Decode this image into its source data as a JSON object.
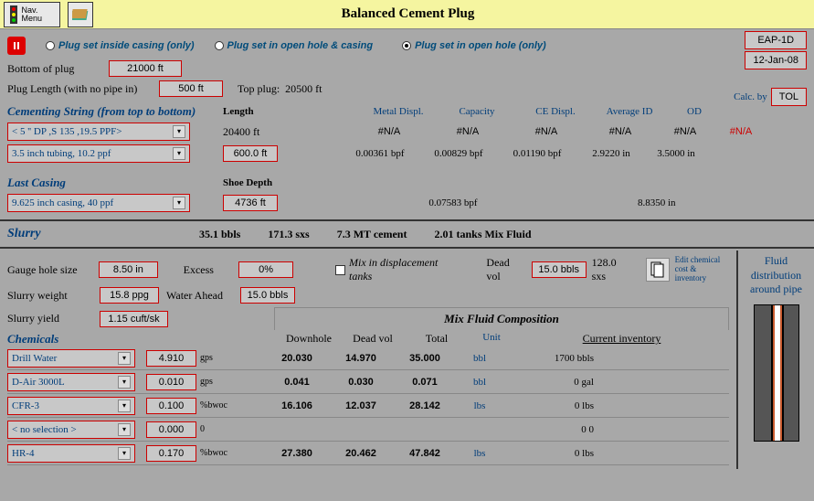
{
  "title": "Balanced Cement Plug",
  "nav_label": "Nav. Menu",
  "radios": {
    "opt1": "Plug set inside casing (only)",
    "opt2": "Plug set in open hole & casing",
    "opt3": "Plug set in open hole (only)"
  },
  "inputs": {
    "bottom_plug_label": "Bottom of plug",
    "bottom_plug": "21000 ft",
    "plug_len_label": "Plug  Length (with no pipe in)",
    "plug_len": "500 ft",
    "top_plug_label": "Top plug:",
    "top_plug": "20500 ft",
    "well": "EAP-1D",
    "date": "12-Jan-08",
    "calc_by": "Calc. by",
    "calc_val": "TOL"
  },
  "cs_header": "Cementing String (from top to bottom)",
  "cols": {
    "length": "Length",
    "md": "Metal Displ.",
    "cap": "Capacity",
    "ced": "CE Displ.",
    "avgid": "Average ID",
    "od": "OD"
  },
  "cs": [
    {
      "name": "< 5 '' DP ,S 135 ,19.5 PPF>",
      "len": "20400 ft",
      "md": "#N/A",
      "cap": "#N/A",
      "ced": "#N/A",
      "avgid": "#N/A",
      "od": "#N/A",
      "err": "#N/A"
    },
    {
      "name": "3.5 inch tubing, 10.2 ppf",
      "len": "600.0 ft",
      "md": "0.00361 bpf",
      "cap": "0.00829 bpf",
      "ced": "0.01190 bpf",
      "avgid": "2.9220 in",
      "od": "3.5000 in",
      "err": ""
    }
  ],
  "lc_header": "Last Casing",
  "lc": {
    "name": "9.625 inch casing, 40 ppf",
    "shoe_label": "Shoe Depth",
    "shoe": "4736 ft",
    "cap": "0.07583 bpf",
    "avgid": "8.8350 in"
  },
  "slurry": {
    "label": "Slurry",
    "bbls": "35.1 bbls",
    "sxs": "171.3 sxs",
    "mt": "7.3 MT cement",
    "tanks": "2.01 tanks Mix Fluid"
  },
  "mid": {
    "gauge_label": "Gauge hole size",
    "gauge": "8.50 in",
    "excess_label": "Excess",
    "excess": "0%",
    "mix_check": "Mix in displacement tanks",
    "dead_label": "Dead vol",
    "dead": "15.0 bbls",
    "dead_sxs": "128.0 sxs",
    "edit_link": "Edit chemical cost & inventory",
    "sw_label": "Slurry weight",
    "sw": "15.8 ppg",
    "wa_label": "Water Ahead",
    "wa": "15.0 bbls",
    "sy_label": "Slurry yield",
    "sy": "1.15 cuft/sk"
  },
  "comp_header": "Mix Fluid Composition",
  "comp_cols": {
    "dh": "Downhole",
    "dv": "Dead vol",
    "tot": "Total",
    "unit": "Unit",
    "inv": "Current inventory"
  },
  "chem_label": "Chemicals",
  "chems": [
    {
      "name": "Drill Water",
      "amt": "4.910",
      "unit": "gps",
      "dh": "20.030",
      "dv": "14.970",
      "tot": "35.000",
      "u2": "bbl",
      "inv": "1700 bbls"
    },
    {
      "name": "D-Air 3000L",
      "amt": "0.010",
      "unit": "gps",
      "dh": "0.041",
      "dv": "0.030",
      "tot": "0.071",
      "u2": "bbl",
      "inv": "0 gal"
    },
    {
      "name": "CFR-3",
      "amt": "0.100",
      "unit": "%bwoc",
      "dh": "16.106",
      "dv": "12.037",
      "tot": "28.142",
      "u2": "lbs",
      "inv": "0 lbs"
    },
    {
      "name": "< no selection >",
      "amt": "0.000",
      "unit": "0",
      "dh": "",
      "dv": "",
      "tot": "",
      "u2": "",
      "inv": "0 0"
    },
    {
      "name": "HR-4",
      "amt": "0.170",
      "unit": "%bwoc",
      "dh": "27.380",
      "dv": "20.462",
      "tot": "47.842",
      "u2": "lbs",
      "inv": "0 lbs"
    }
  ],
  "fluid_dist": "Fluid distribution around pipe"
}
